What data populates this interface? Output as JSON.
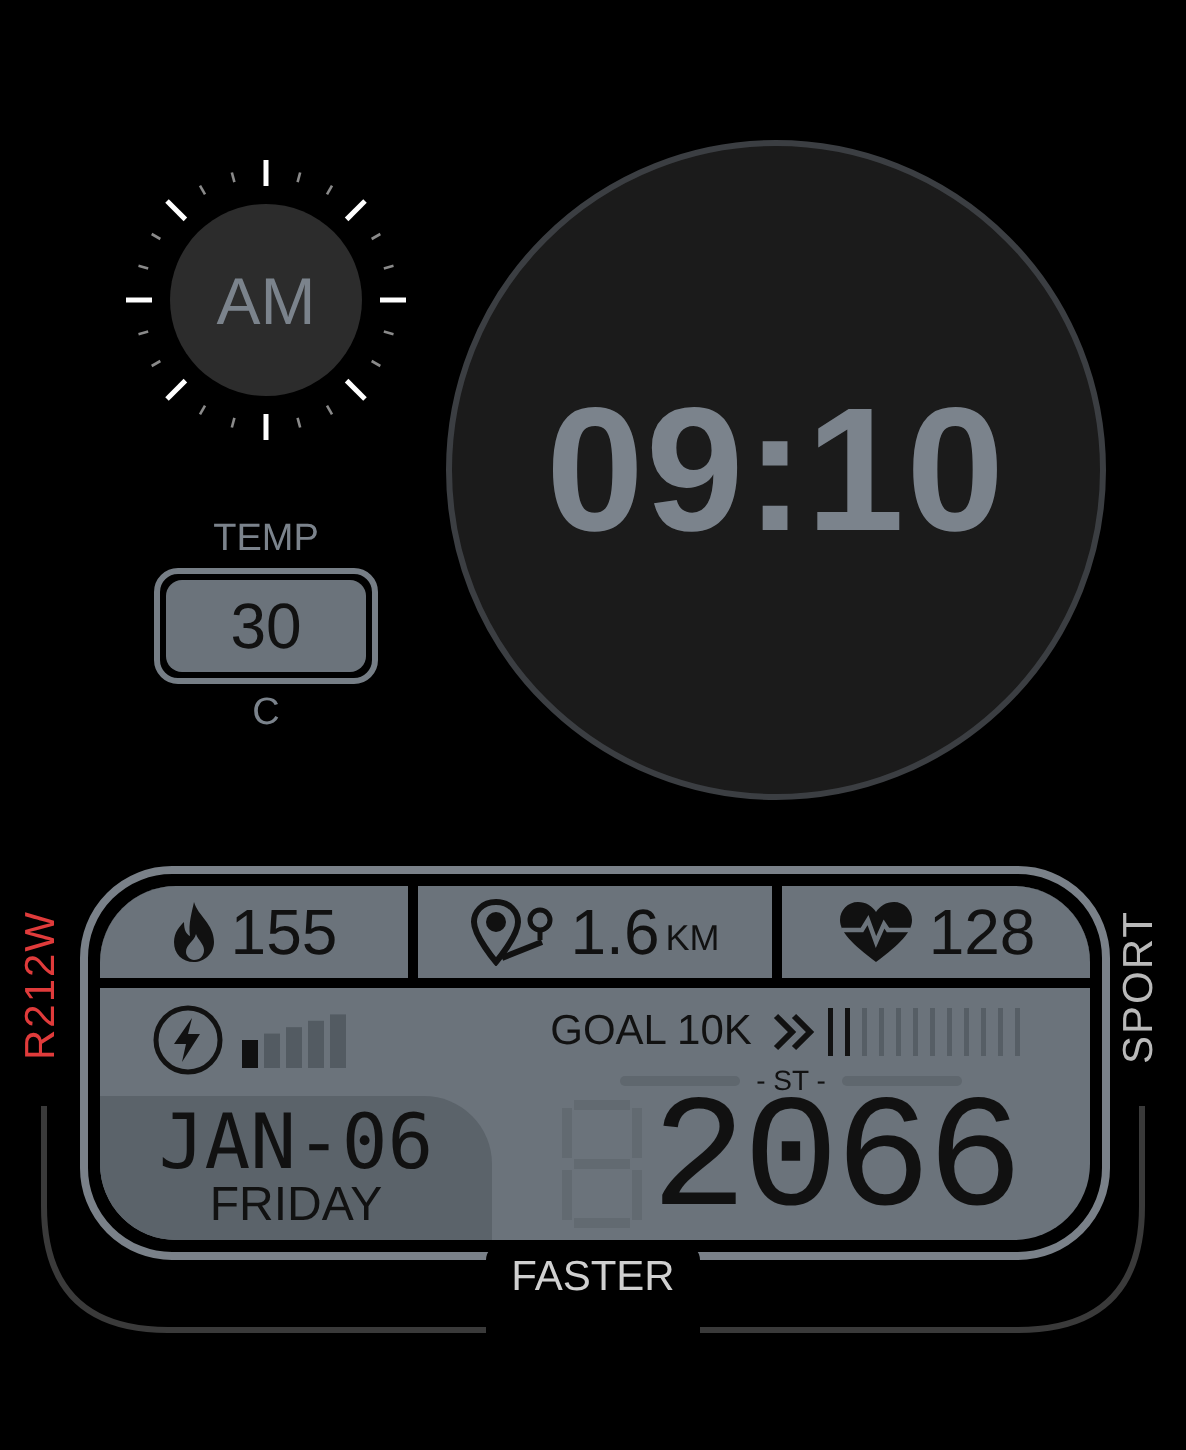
{
  "ampm": {
    "label": "AM"
  },
  "time": "09:10",
  "temperature": {
    "label": "TEMP",
    "value": "30",
    "unit": "C"
  },
  "model": "R212W",
  "mode": "SPORT",
  "stats": [
    {
      "kind": "calories",
      "value": "155"
    },
    {
      "kind": "distance",
      "value": "1.6",
      "unit": "KM"
    },
    {
      "kind": "heart_rate",
      "value": "128"
    }
  ],
  "battery": {
    "level": 0.2
  },
  "goal": {
    "label": "GOAL 10K",
    "level": 0.17
  },
  "steps": {
    "label": "- ST -",
    "value": "2066"
  },
  "date": {
    "date": "JAN-06",
    "weekday": "FRIDAY"
  },
  "tag": "FASTER"
}
